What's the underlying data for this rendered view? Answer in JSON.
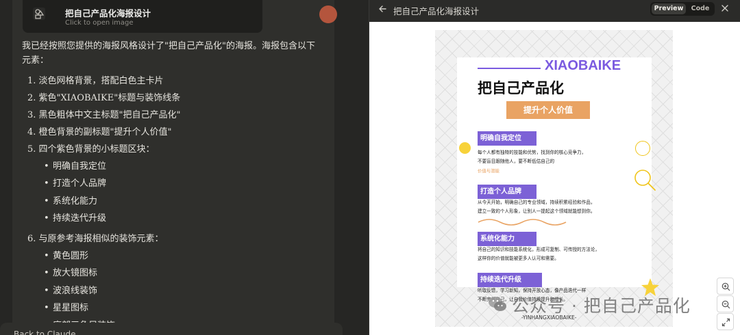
{
  "artifact_card": {
    "title": "把自己产品化海报设计",
    "subtitle": "Click to open image"
  },
  "message": {
    "intro": "我已经按照您提供的海报风格设计了\"把自己产品化\"的海报。海报包含以下元素：",
    "items": [
      "1. 淡色网格背景，搭配白色主卡片",
      "2. 紫色\"XIAOBAIKE\"标题与装饰线条",
      "3. 黑色粗体中文主标题\"把自己产品化\"",
      "4. 橙色背景的副标题\"提升个人价值\"",
      "5. 四个紫色背景的小标题区块："
    ],
    "sub_items_1": [
      "明确自我定位",
      "打造个人品牌",
      "系统化能力",
      "持续迭代升级"
    ],
    "item_6": "6. 与原参考海报相似的装饰元素：",
    "sub_items_2": [
      "黄色圆形",
      "放大镜图标",
      "波浪线装饰",
      "星星图标",
      "底部三角尺装饰"
    ]
  },
  "bottom_bar": {
    "label": "Back to Claude"
  },
  "panel": {
    "title": "把自己产品化海报设计",
    "preview_label": "Preview",
    "code_label": "Code",
    "active_tab": "Preview"
  },
  "poster": {
    "brand": "XIAOBAIKE",
    "title": "把自己产品化",
    "subtitle": "提升个人价值",
    "sections": [
      {
        "label": "明确自我定位",
        "lines": [
          "每个人都有独特的技能和优势，找到你的核心竞争力，",
          "不要盲目跟随他人，要不断低估自己的"
        ],
        "hint": "价值与潜能"
      },
      {
        "label": "打造个人品牌",
        "lines": [
          "从今天开始，明确自己的专业领域，持续积累经验和作品，",
          "建立一致的个人形象，让别人一提起这个领域就能想到你。"
        ]
      },
      {
        "label": "系统化能力",
        "lines": [
          "将自己的知识和技能系统化，形成可复制、可传授的方法论，",
          "这样你的价值就能被更多人认可和需要。"
        ]
      },
      {
        "label": "持续迭代升级",
        "lines": [
          "听取反馈，学习新知，保持开放心态，像产品迭代一样",
          "不断完善自己，让自我价值持续提升和增长。"
        ]
      }
    ],
    "footer": "-YINHANGXIAOBAIKE-",
    "watermark": "公众号 · 把自己产品化"
  },
  "colors": {
    "purple": "#7a5ae0",
    "orange": "#e9a363",
    "yellow": "#f7d23a"
  }
}
